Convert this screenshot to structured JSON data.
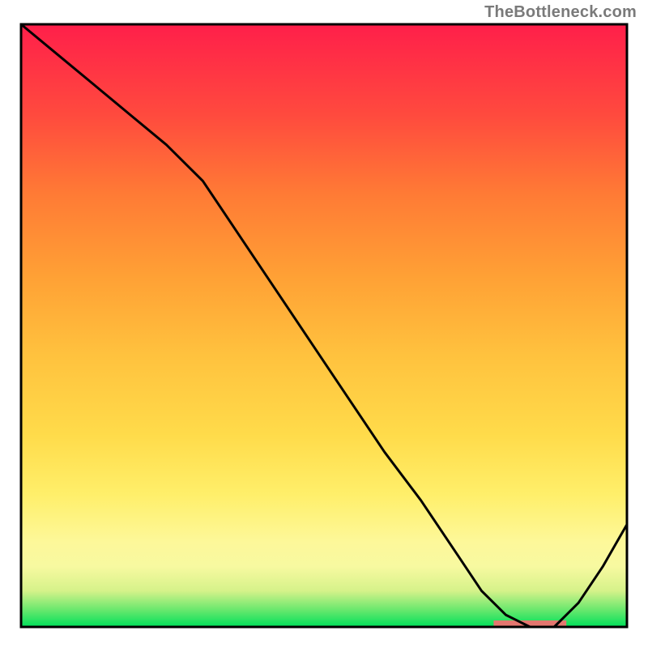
{
  "watermark": "TheBottleneck.com",
  "chart_data": {
    "type": "line",
    "title": "",
    "xlabel": "",
    "ylabel": "",
    "xlim": [
      0,
      100
    ],
    "ylim": [
      0,
      100
    ],
    "x": [
      0,
      6,
      12,
      18,
      24,
      30,
      36,
      42,
      48,
      54,
      60,
      66,
      72,
      76,
      80,
      84,
      88,
      92,
      96,
      100
    ],
    "values": [
      100,
      95,
      90,
      85,
      80,
      74,
      65,
      56,
      47,
      38,
      29,
      21,
      12,
      6,
      2,
      0,
      0,
      4,
      10,
      17
    ],
    "optimal_range_x": [
      78,
      90
    ],
    "gradient_stops": [
      {
        "offset": 0.0,
        "color": "#00e05a"
      },
      {
        "offset": 0.03,
        "color": "#6fe86f"
      },
      {
        "offset": 0.06,
        "color": "#d6f28a"
      },
      {
        "offset": 0.1,
        "color": "#f7f9a0"
      },
      {
        "offset": 0.14,
        "color": "#fdf89a"
      },
      {
        "offset": 0.22,
        "color": "#ffef6a"
      },
      {
        "offset": 0.32,
        "color": "#ffdb4a"
      },
      {
        "offset": 0.45,
        "color": "#ffc23e"
      },
      {
        "offset": 0.58,
        "color": "#ffa135"
      },
      {
        "offset": 0.72,
        "color": "#ff7a35"
      },
      {
        "offset": 0.85,
        "color": "#ff4a3e"
      },
      {
        "offset": 1.0,
        "color": "#ff1f4a"
      }
    ],
    "line_color": "#000000",
    "line_width": 3,
    "frame_color": "#000000",
    "frame_width": 3,
    "optimal_bar_color": "#e4776f"
  }
}
